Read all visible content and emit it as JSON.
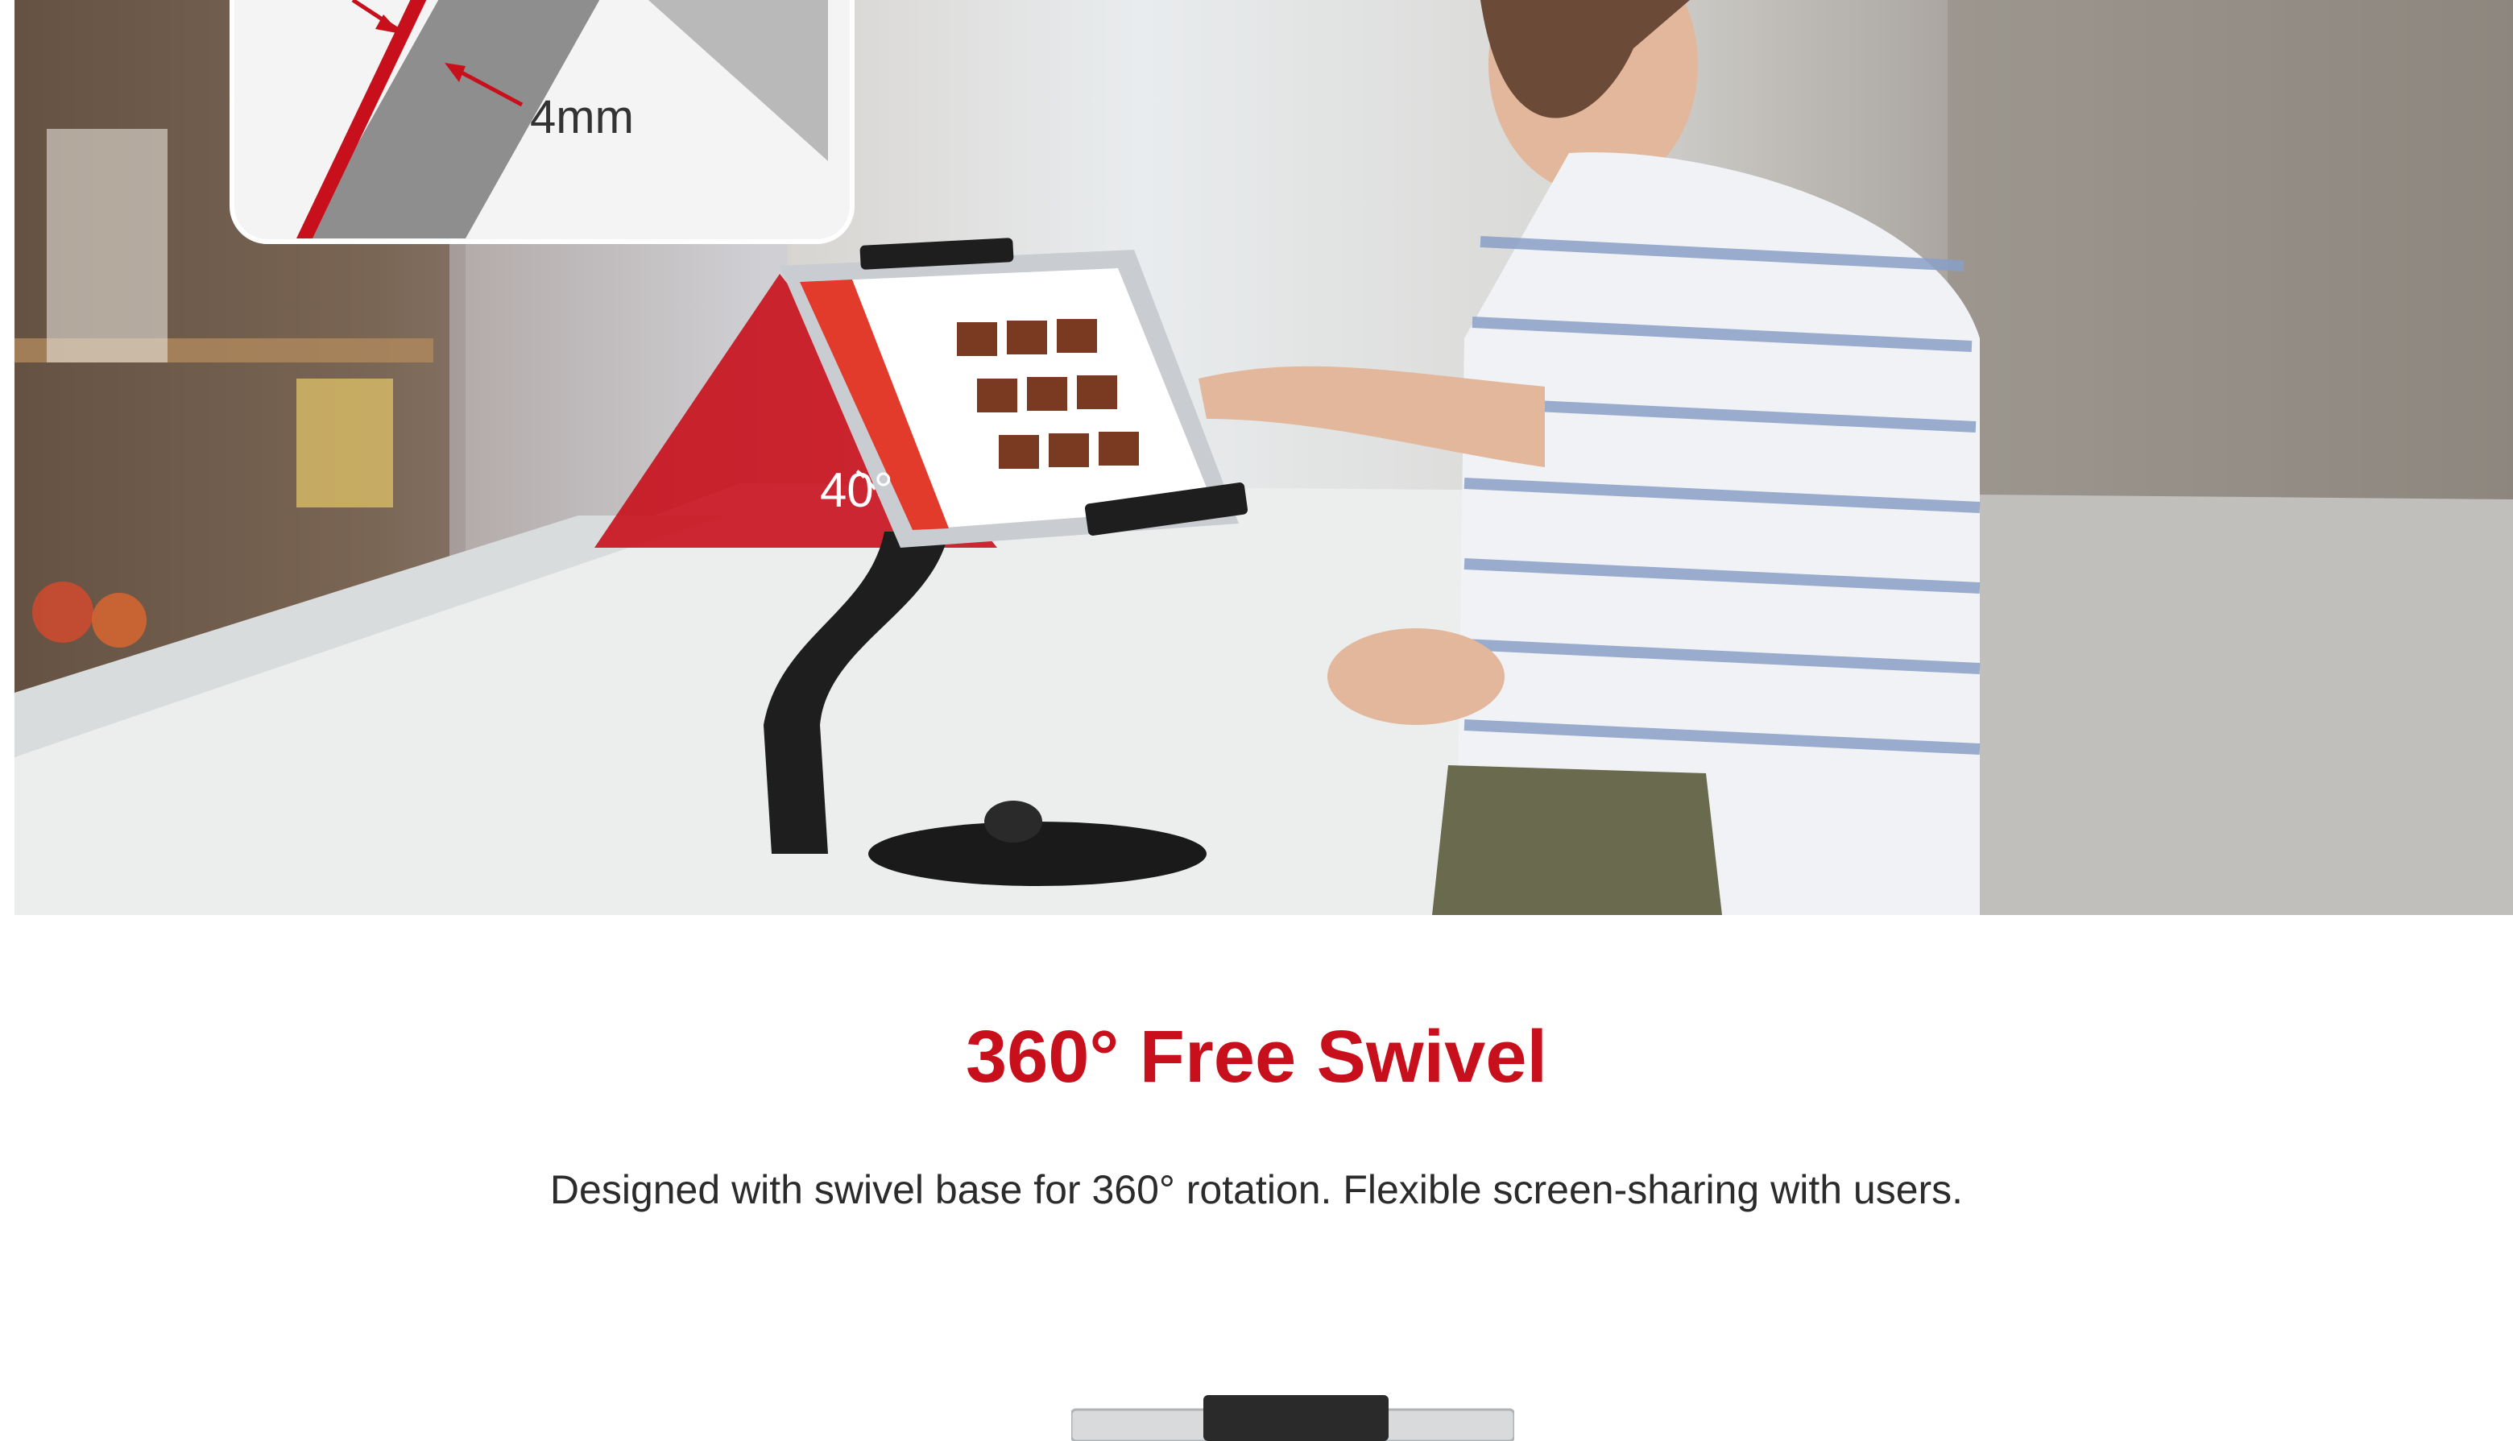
{
  "hero": {
    "callout_measure": "4mm",
    "tilt_angle": "40°"
  },
  "feature": {
    "title": "360° Free Swivel",
    "description": "Designed with swivel base for 360° rotation. Flexible screen-sharing with users."
  },
  "colors": {
    "accent": "#c8101c",
    "stand": "#1e1e1e",
    "text": "#2b2b2b"
  }
}
